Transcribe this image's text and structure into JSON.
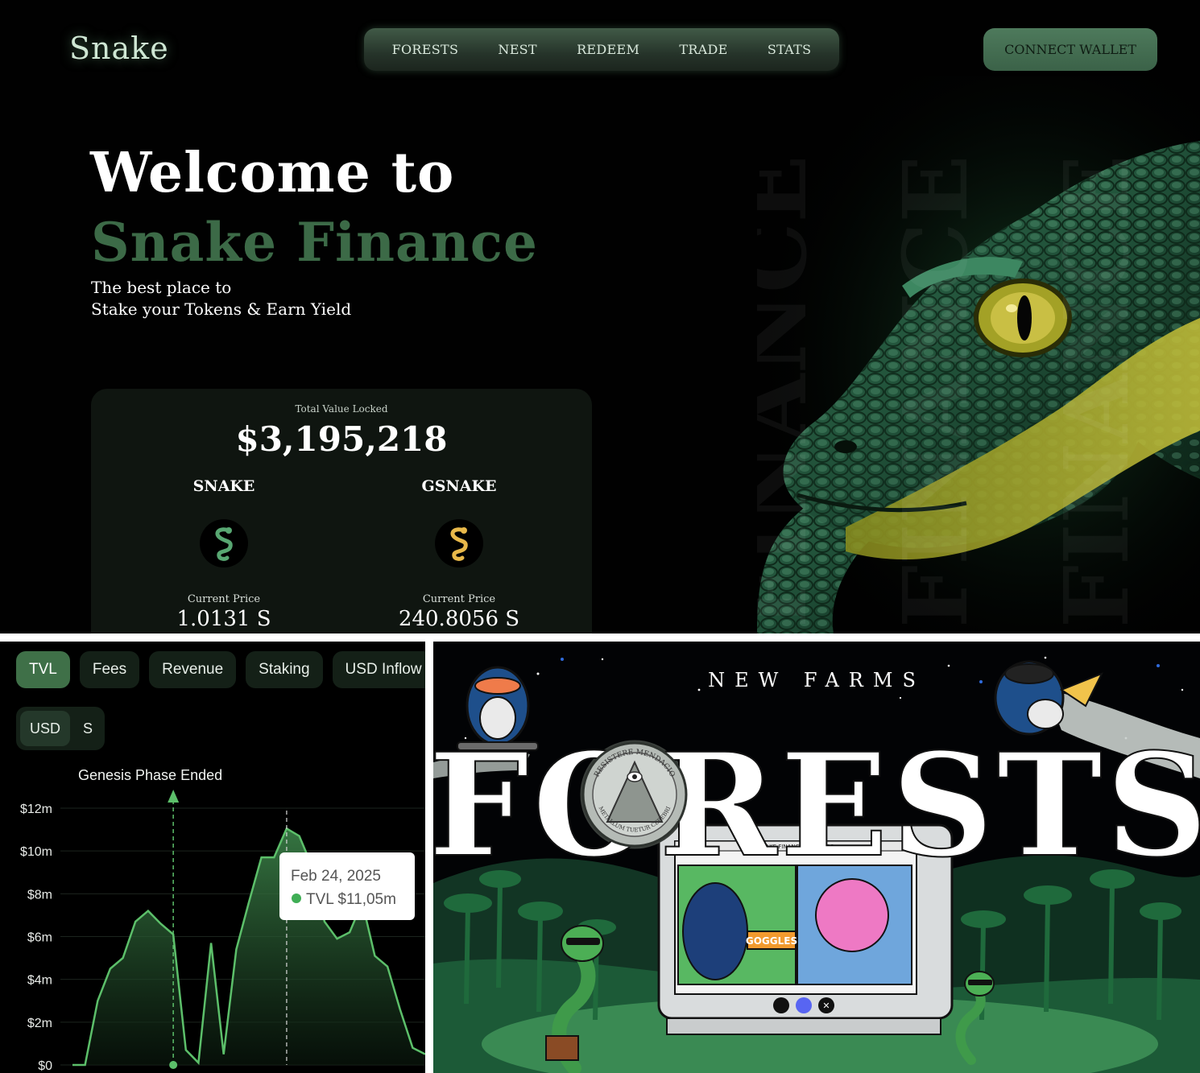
{
  "header": {
    "logo": "Snake",
    "nav": [
      "FORESTS",
      "NEST",
      "REDEEM",
      "TRADE",
      "STATS"
    ],
    "connect_button": "CONNECT WALLET"
  },
  "hero": {
    "title_line1": "Welcome to",
    "title_line2": "Snake Finance",
    "subtitle_line1": "The best place to",
    "subtitle_line2": "Stake your Tokens & Earn Yield",
    "watermark": "FINANCE"
  },
  "tvl_card": {
    "label": "Total Value Locked",
    "value": "$3,195,218",
    "tokens": [
      {
        "name": "SNAKE",
        "price_label": "Current Price",
        "price": "1.0131 S",
        "icon_color": "#58a772"
      },
      {
        "name": "GSNAKE",
        "price_label": "Current Price",
        "price": "240.8056 S",
        "icon_color": "#e8b84a"
      }
    ]
  },
  "chart_panel": {
    "tabs": [
      "TVL",
      "Fees",
      "Revenue",
      "Staking",
      "USD Inflow"
    ],
    "active_tab": "TVL",
    "currency_options": [
      "USD",
      "S"
    ],
    "active_currency": "USD",
    "watermark_fragment": "D"
  },
  "chart_data": {
    "type": "area",
    "title": "",
    "xlabel": "",
    "ylabel": "",
    "ylim": [
      0,
      12
    ],
    "y_ticks": [
      "$0",
      "$2m",
      "$4m",
      "$6m",
      "$8m",
      "$10m",
      "$12m"
    ],
    "grid": true,
    "series": [
      {
        "name": "TVL",
        "color": "#5cbf6a",
        "values": [
          0,
          0,
          3,
          4.5,
          5,
          6.7,
          7.2,
          6.6,
          6.1,
          0.7,
          0.1,
          5.7,
          0.5,
          5.4,
          7.6,
          9.7,
          9.7,
          11.05,
          10.7,
          9.3,
          6.7,
          5.9,
          6.2,
          7.6,
          5.1,
          4.6,
          2.6,
          0.8,
          0.5
        ]
      }
    ],
    "annotations": [
      {
        "label": "Genesis Phase Ended",
        "index": 8
      }
    ],
    "tooltip": {
      "date": "Feb 24, 2025",
      "series": "TVL",
      "value": "$11,05m",
      "index": 17
    }
  },
  "forest_panel": {
    "heading": "NEW FARMS",
    "title": "FORESTS",
    "monitor_title": "SNAKE FINANCE PARTNERS",
    "tile_caption": "GOGGLES",
    "coin_text": "RESISTERE MENDACIO",
    "coin_bottom": "METALLUM TUETUR CEREBRI",
    "social_icons": [
      "snake-icon",
      "discord-icon",
      "x-icon"
    ]
  }
}
